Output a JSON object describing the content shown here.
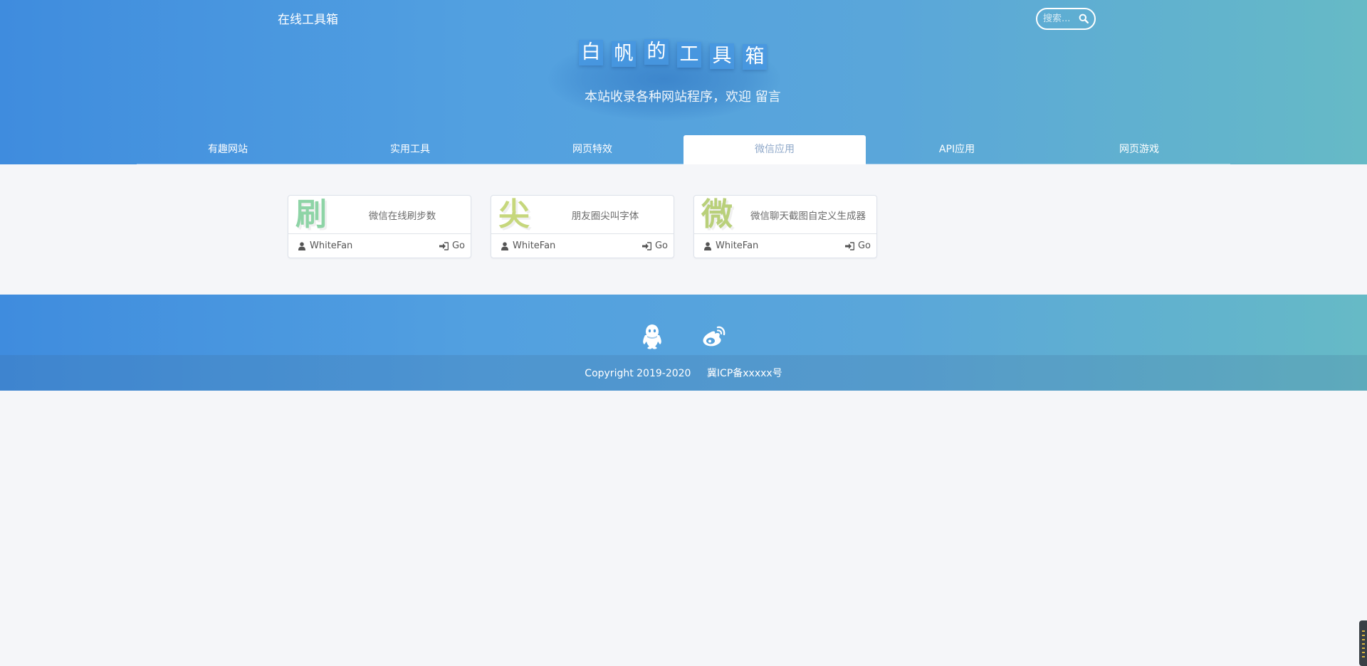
{
  "header": {
    "brand": "在线工具箱",
    "search_placeholder": "搜索...",
    "site_title_chars": [
      "白",
      "帆",
      "的",
      "工",
      "具",
      "箱"
    ],
    "subtitle_text": "本站收录各种网站程序，欢迎",
    "subtitle_link": "留言"
  },
  "tabs": [
    {
      "label": "有趣网站",
      "active": false
    },
    {
      "label": "实用工具",
      "active": false
    },
    {
      "label": "网页特效",
      "active": false
    },
    {
      "label": "微信应用",
      "active": true
    },
    {
      "label": "API应用",
      "active": false
    },
    {
      "label": "网页游戏",
      "active": false
    }
  ],
  "cards": [
    {
      "glyph": "刷",
      "glyph_color": "#8ed4a6",
      "title": "微信在线刷步数",
      "author": "WhiteFan",
      "go_label": "Go"
    },
    {
      "glyph": "尖",
      "glyph_color": "#c6d77c",
      "title": "朋友圈尖叫字体",
      "author": "WhiteFan",
      "go_label": "Go"
    },
    {
      "glyph": "微",
      "glyph_color": "#b9d07a",
      "title": "微信聊天截图自定义生成器",
      "author": "WhiteFan",
      "go_label": "Go"
    }
  ],
  "footer": {
    "icons": [
      "qq-icon",
      "weibo-icon"
    ],
    "copyright": "Copyright 2019-2020",
    "icp": "冀ICP备xxxxx号"
  },
  "colors": {
    "gradient_start": "#3f8cde",
    "gradient_end": "#66bac6",
    "active_tab_text": "#8fa8c9",
    "page_background": "#f5f6f9"
  }
}
